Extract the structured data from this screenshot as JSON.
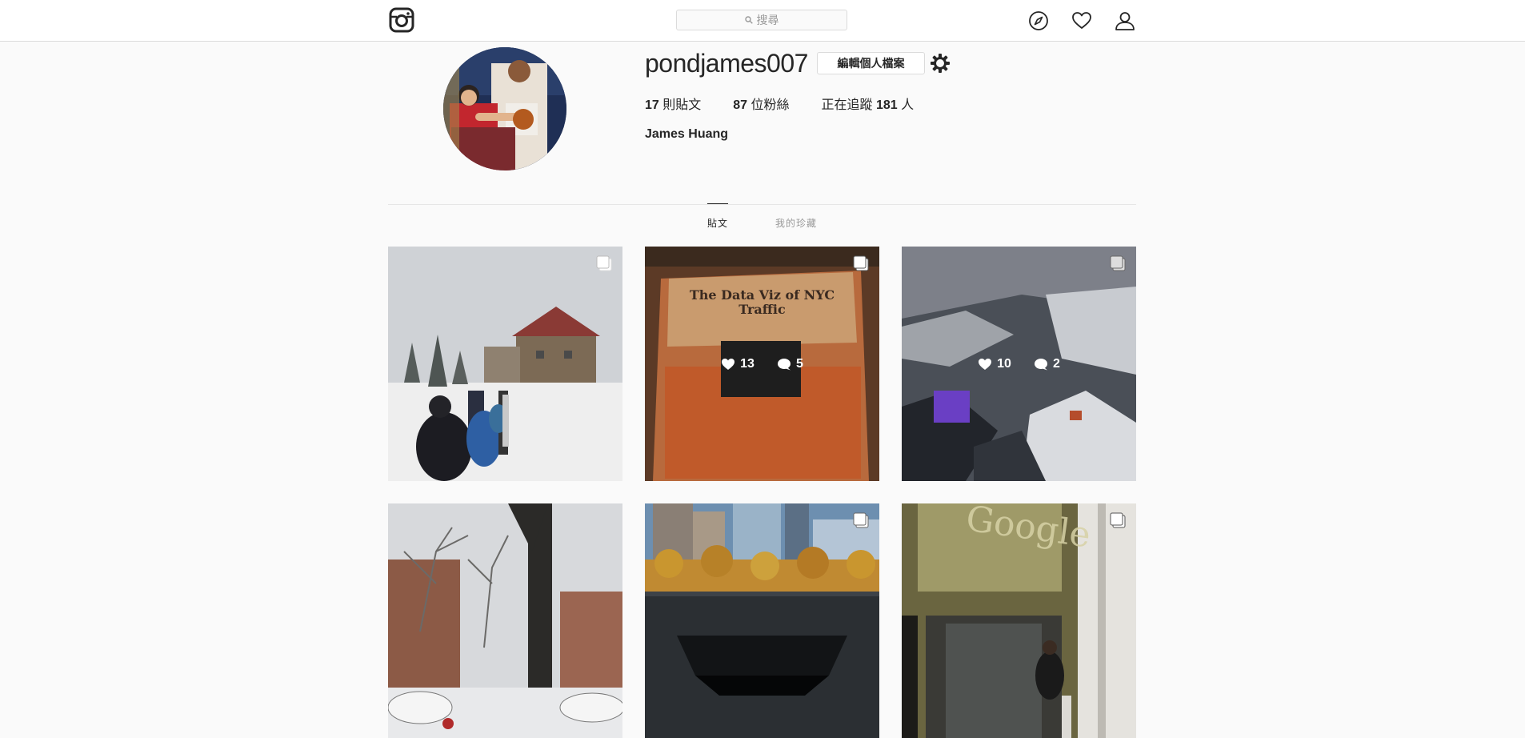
{
  "header": {
    "search_placeholder": "搜尋",
    "icons": [
      "instagram-logo-icon",
      "compass-icon",
      "heart-icon",
      "person-icon"
    ]
  },
  "profile": {
    "username": "pondjames007",
    "edit_button": "編輯個人檔案",
    "posts_count": "17",
    "posts_label": " 則貼文",
    "followers_count": "87",
    "followers_label": " 位粉絲",
    "following_prefix": "正在追蹤 ",
    "following_count": "181",
    "following_suffix": " 人",
    "full_name": "James Huang"
  },
  "tabs": [
    {
      "label": "貼文",
      "active": true
    },
    {
      "label": "我的珍藏",
      "active": false
    }
  ],
  "posts": [
    {
      "multi": true,
      "likes": null,
      "comments": null
    },
    {
      "multi": true,
      "likes": "13",
      "comments": "5",
      "text_lines": [
        "The Data Viz of NYC",
        "Traffic"
      ]
    },
    {
      "multi": true,
      "likes": "10",
      "comments": "2"
    },
    {
      "multi": false,
      "likes": null,
      "comments": null
    },
    {
      "multi": true,
      "likes": null,
      "comments": null
    },
    {
      "multi": true,
      "likes": null,
      "comments": null,
      "sign_text": "Google"
    }
  ],
  "colors": {
    "accent": "#262626",
    "border": "#dbdbdb",
    "bg": "#fafafa"
  }
}
